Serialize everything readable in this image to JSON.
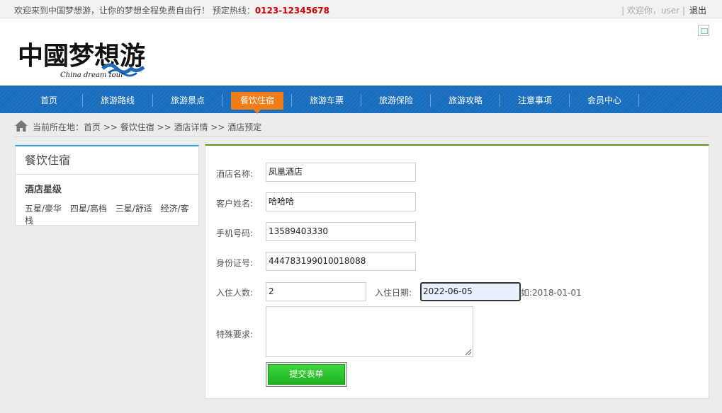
{
  "topbar": {
    "welcome": "欢迎来到中国梦想游，让你的梦想全程免费自由行！ 预定热线：",
    "hotline": "0123-12345678",
    "greeting": "| 欢迎你，user |",
    "logout": "退出"
  },
  "header": {
    "logo_cn": "中國梦想游",
    "logo_en": "China dream tour"
  },
  "nav": {
    "items": [
      "首页",
      "旅游路线",
      "旅游景点",
      "餐饮住宿",
      "旅游车票",
      "旅游保险",
      "旅游攻略",
      "注意事项",
      "会员中心"
    ],
    "active": "餐饮住宿"
  },
  "breadcrumb": {
    "text": "当前所在地：首页 >> 餐饮住宿 >> 酒店详情 >> 酒店预定"
  },
  "sidebar": {
    "title": "餐饮住宿",
    "subtitle": "酒店星级",
    "stars": [
      "五星/豪华",
      "四星/高档",
      "三星/舒适",
      "经济/客栈"
    ]
  },
  "form": {
    "hotel_label": "酒店名称:",
    "hotel_value": "凤凰酒店",
    "name_label": "客户姓名:",
    "name_value": "哈哈哈",
    "phone_label": "手机号码:",
    "phone_value": "13589403330",
    "id_label": "身份证号:",
    "id_value": "444783199010018088",
    "guests_label": "入住人数:",
    "guests_value": "2",
    "date_label": "入住日期:",
    "date_value": "2022-06-05",
    "date_hint": "如:2018-01-01",
    "request_label": "特殊要求:",
    "request_value": "",
    "submit_label": "提交表单"
  },
  "colors": {
    "nav_blue": "#1a6bb8",
    "nav_active": "#f07c1a",
    "hotline": "#d10000",
    "submit_green": "#2bc42b",
    "panel_accent": "#5a9a1a",
    "sidebar_accent": "#2da3dc"
  }
}
